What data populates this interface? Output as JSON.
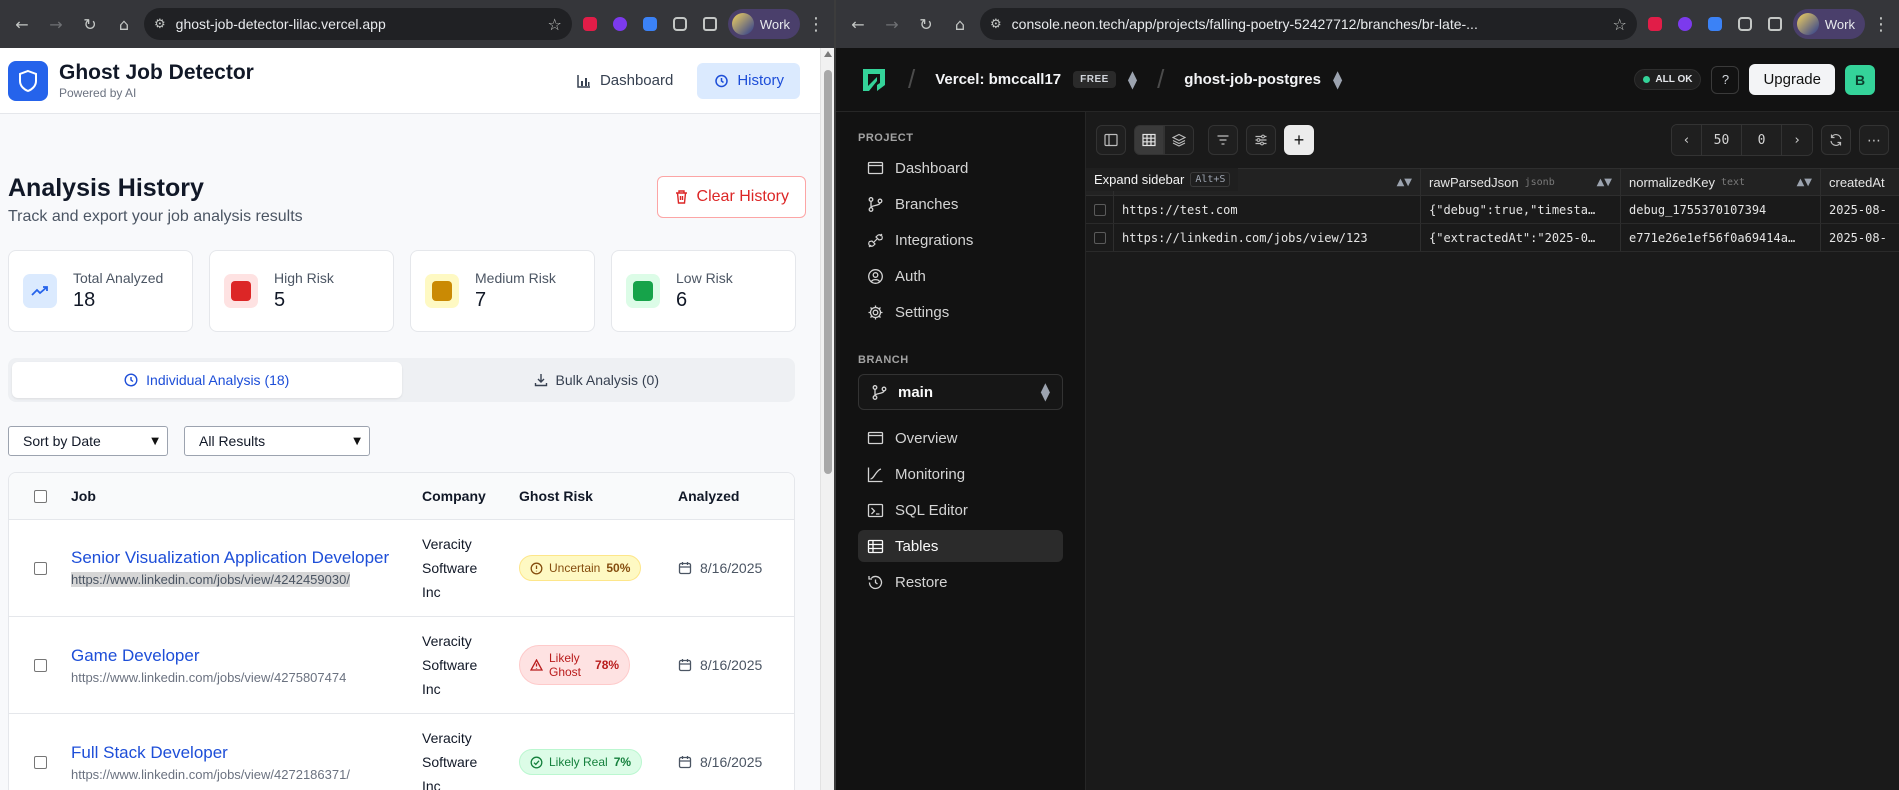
{
  "left_browser": {
    "url": "ghost-job-detector-lilac.vercel.app",
    "profile": "Work"
  },
  "right_browser": {
    "url": "console.neon.tech/app/projects/falling-poetry-52427712/branches/br-late-...",
    "profile": "Work"
  },
  "app": {
    "name": "Ghost Job Detector",
    "tagline": "Powered by AI",
    "nav": {
      "dashboard": "Dashboard",
      "history": "History"
    },
    "page_title": "Analysis History",
    "page_desc": "Track and export your job analysis results",
    "clear_btn": "Clear History",
    "stats": [
      {
        "label": "Total Analyzed",
        "value": "18",
        "color": "#2563eb"
      },
      {
        "label": "High Risk",
        "value": "5",
        "color": "#dc2626"
      },
      {
        "label": "Medium Risk",
        "value": "7",
        "color": "#ca8a04"
      },
      {
        "label": "Low Risk",
        "value": "6",
        "color": "#16a34a"
      }
    ],
    "tabs": {
      "individual": "Individual Analysis (18)",
      "bulk": "Bulk Analysis (0)"
    },
    "filters": {
      "sort": "Sort by Date",
      "result": "All Results"
    },
    "table": {
      "headers": {
        "job": "Job",
        "company": "Company",
        "risk": "Ghost Risk",
        "analyzed": "Analyzed"
      },
      "rows": [
        {
          "title": "Senior Visualization Application Developer",
          "url": "https://www.linkedin.com/jobs/view/4242459030/",
          "company_l1": "Veracity",
          "company_l2": "Software",
          "company_l3": "Inc",
          "risk_label": "Uncertain",
          "risk_pct": "50%",
          "date": "8/16/2025"
        },
        {
          "title": "Game Developer",
          "url": "https://www.linkedin.com/jobs/view/4275807474",
          "company_l1": "Veracity",
          "company_l2": "Software",
          "company_l3": "Inc",
          "risk_label_1": "Likely",
          "risk_label_2": "Ghost",
          "risk_pct": "78%",
          "date": "8/16/2025"
        },
        {
          "title": "Full Stack Developer",
          "url": "https://www.linkedin.com/jobs/view/4272186371/",
          "company_l1": "Veracity",
          "company_l2": "Software",
          "company_l3": "Inc",
          "risk_label": "Likely Real",
          "risk_pct": "7%",
          "date": "8/16/2025"
        }
      ]
    }
  },
  "neon": {
    "org": "Vercel: bmccall17",
    "plan": "FREE",
    "project": "ghost-job-postgres",
    "status": "ALL OK",
    "upgrade": "Upgrade",
    "user_initial": "B",
    "project_label": "PROJECT",
    "project_items": [
      "Dashboard",
      "Branches",
      "Integrations",
      "Auth",
      "Settings"
    ],
    "branch_label": "BRANCH",
    "branch": "main",
    "branch_items": [
      "Overview",
      "Monitoring",
      "SQL Editor",
      "Tables",
      "Restore"
    ],
    "page_size": "50",
    "offset": "0",
    "tooltip": {
      "text": "Expand sidebar",
      "shortcut": "Alt+S"
    },
    "columns": [
      {
        "name": "rawParsedJson",
        "type": "jsonb"
      },
      {
        "name": "normalizedKey",
        "type": "text"
      },
      {
        "name": "createdAt",
        "type": ""
      }
    ],
    "rows": [
      {
        "url": "https://test.com",
        "json": "{\"debug\":true,\"timesta…",
        "key": "debug_1755370107394",
        "created": "2025-08-"
      },
      {
        "url": "https://linkedin.com/jobs/view/123",
        "json": "{\"extractedAt\":\"2025-0…",
        "key": "e771e26e1ef56f0a69414a…",
        "created": "2025-08-"
      }
    ]
  }
}
